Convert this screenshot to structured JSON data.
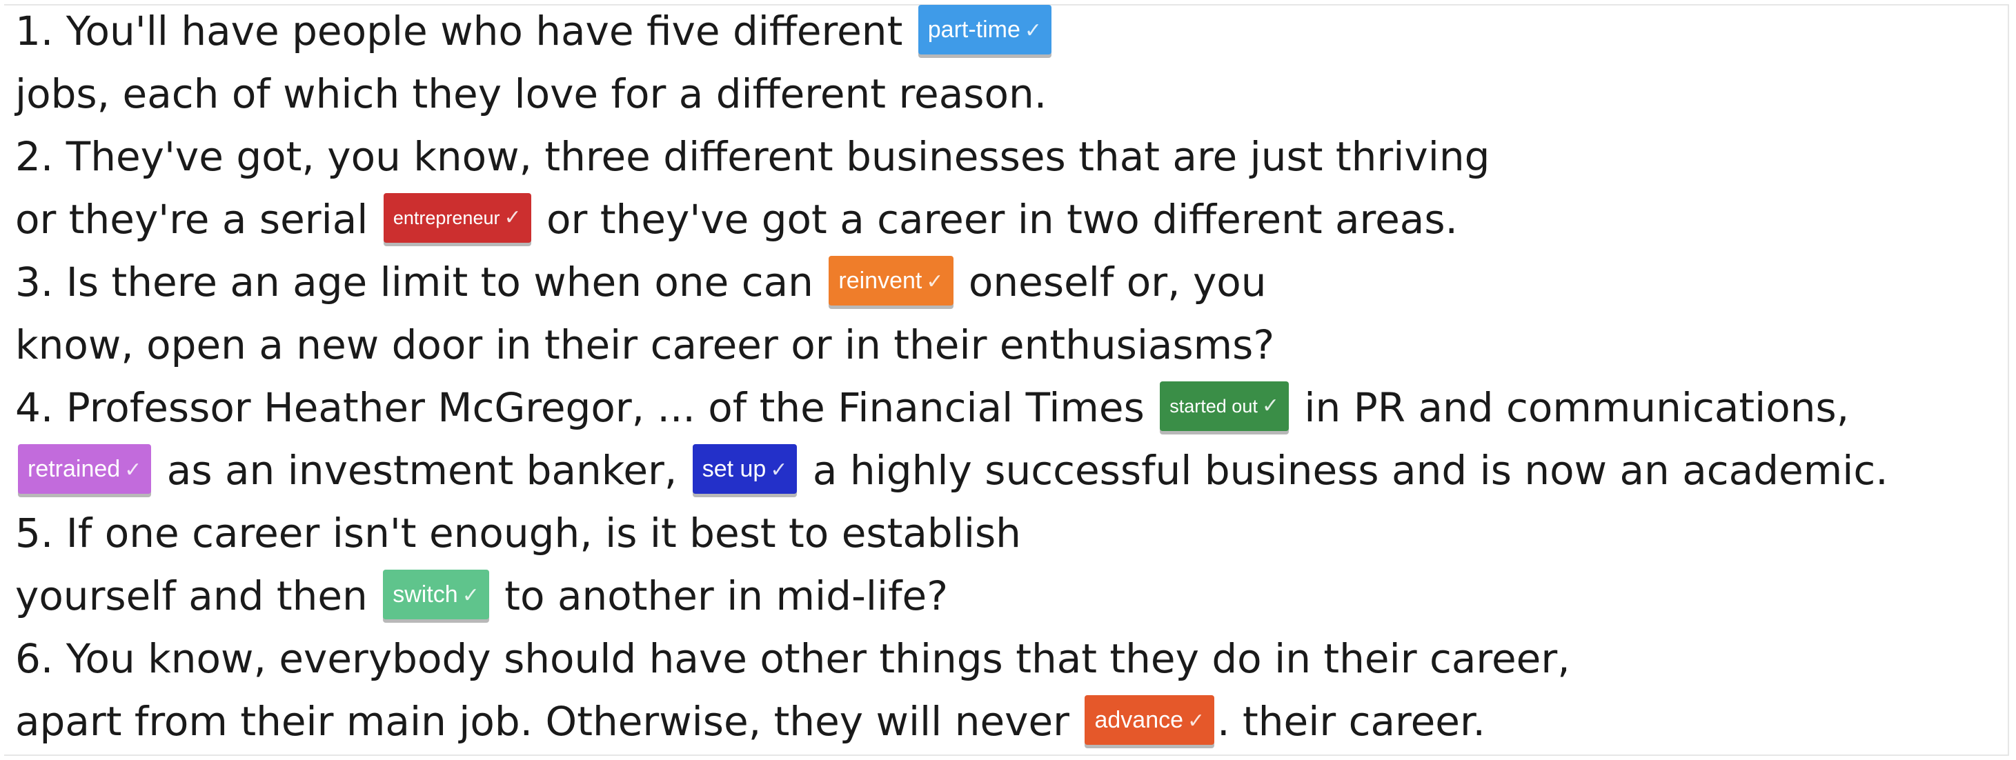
{
  "exercise": {
    "check_glyph": "✓",
    "lines": [
      {
        "pre": "1. You'll have people who have five different ",
        "chip": {
          "label": "part-time",
          "color": "#3f9be8"
        },
        "post": ""
      },
      {
        "pre": "jobs, each of which they love for a different reason.",
        "chip": null,
        "post": ""
      },
      {
        "pre": "2. They've got, you know, three different businesses that are just thriving",
        "chip": null,
        "post": ""
      },
      {
        "pre": "or they're a serial ",
        "chip": {
          "label": "entrepreneur",
          "color": "#cc2f2f",
          "small": true
        },
        "post": " or they've got a career in two different areas."
      },
      {
        "pre": "3. Is there an age limit to when one can ",
        "chip": {
          "label": "reinvent",
          "color": "#ef7d2a"
        },
        "post": " oneself or, you"
      },
      {
        "pre": "know, open a new door in their career or in their enthusiasms?",
        "chip": null,
        "post": ""
      },
      {
        "pre": "4. Professor Heather McGregor, ... of the Financial Times ",
        "chip": {
          "label": "started out",
          "color": "#3a8e47",
          "small": true
        },
        "post": " in PR and communications,"
      },
      {
        "pre": "",
        "chip": {
          "label": "retrained",
          "color": "#c26bdc"
        },
        "post": " as an investment banker, ",
        "chip2": {
          "label": "set up",
          "color": "#2330c9"
        },
        "post2": " a highly successful business and is now an academic."
      },
      {
        "pre": "5. If one career isn't enough, is it best to establish",
        "chip": null,
        "post": ""
      },
      {
        "pre": "yourself and then ",
        "chip": {
          "label": "switch",
          "color": "#5fc48c"
        },
        "post": " to another in mid-life?"
      },
      {
        "pre": "6. You know, everybody should have other things that they do in their career,",
        "chip": null,
        "post": ""
      },
      {
        "pre": "apart from their main job. Otherwise, they will never ",
        "chip": {
          "label": "advance",
          "color": "#e5582a"
        },
        "post": ". their career."
      }
    ]
  }
}
